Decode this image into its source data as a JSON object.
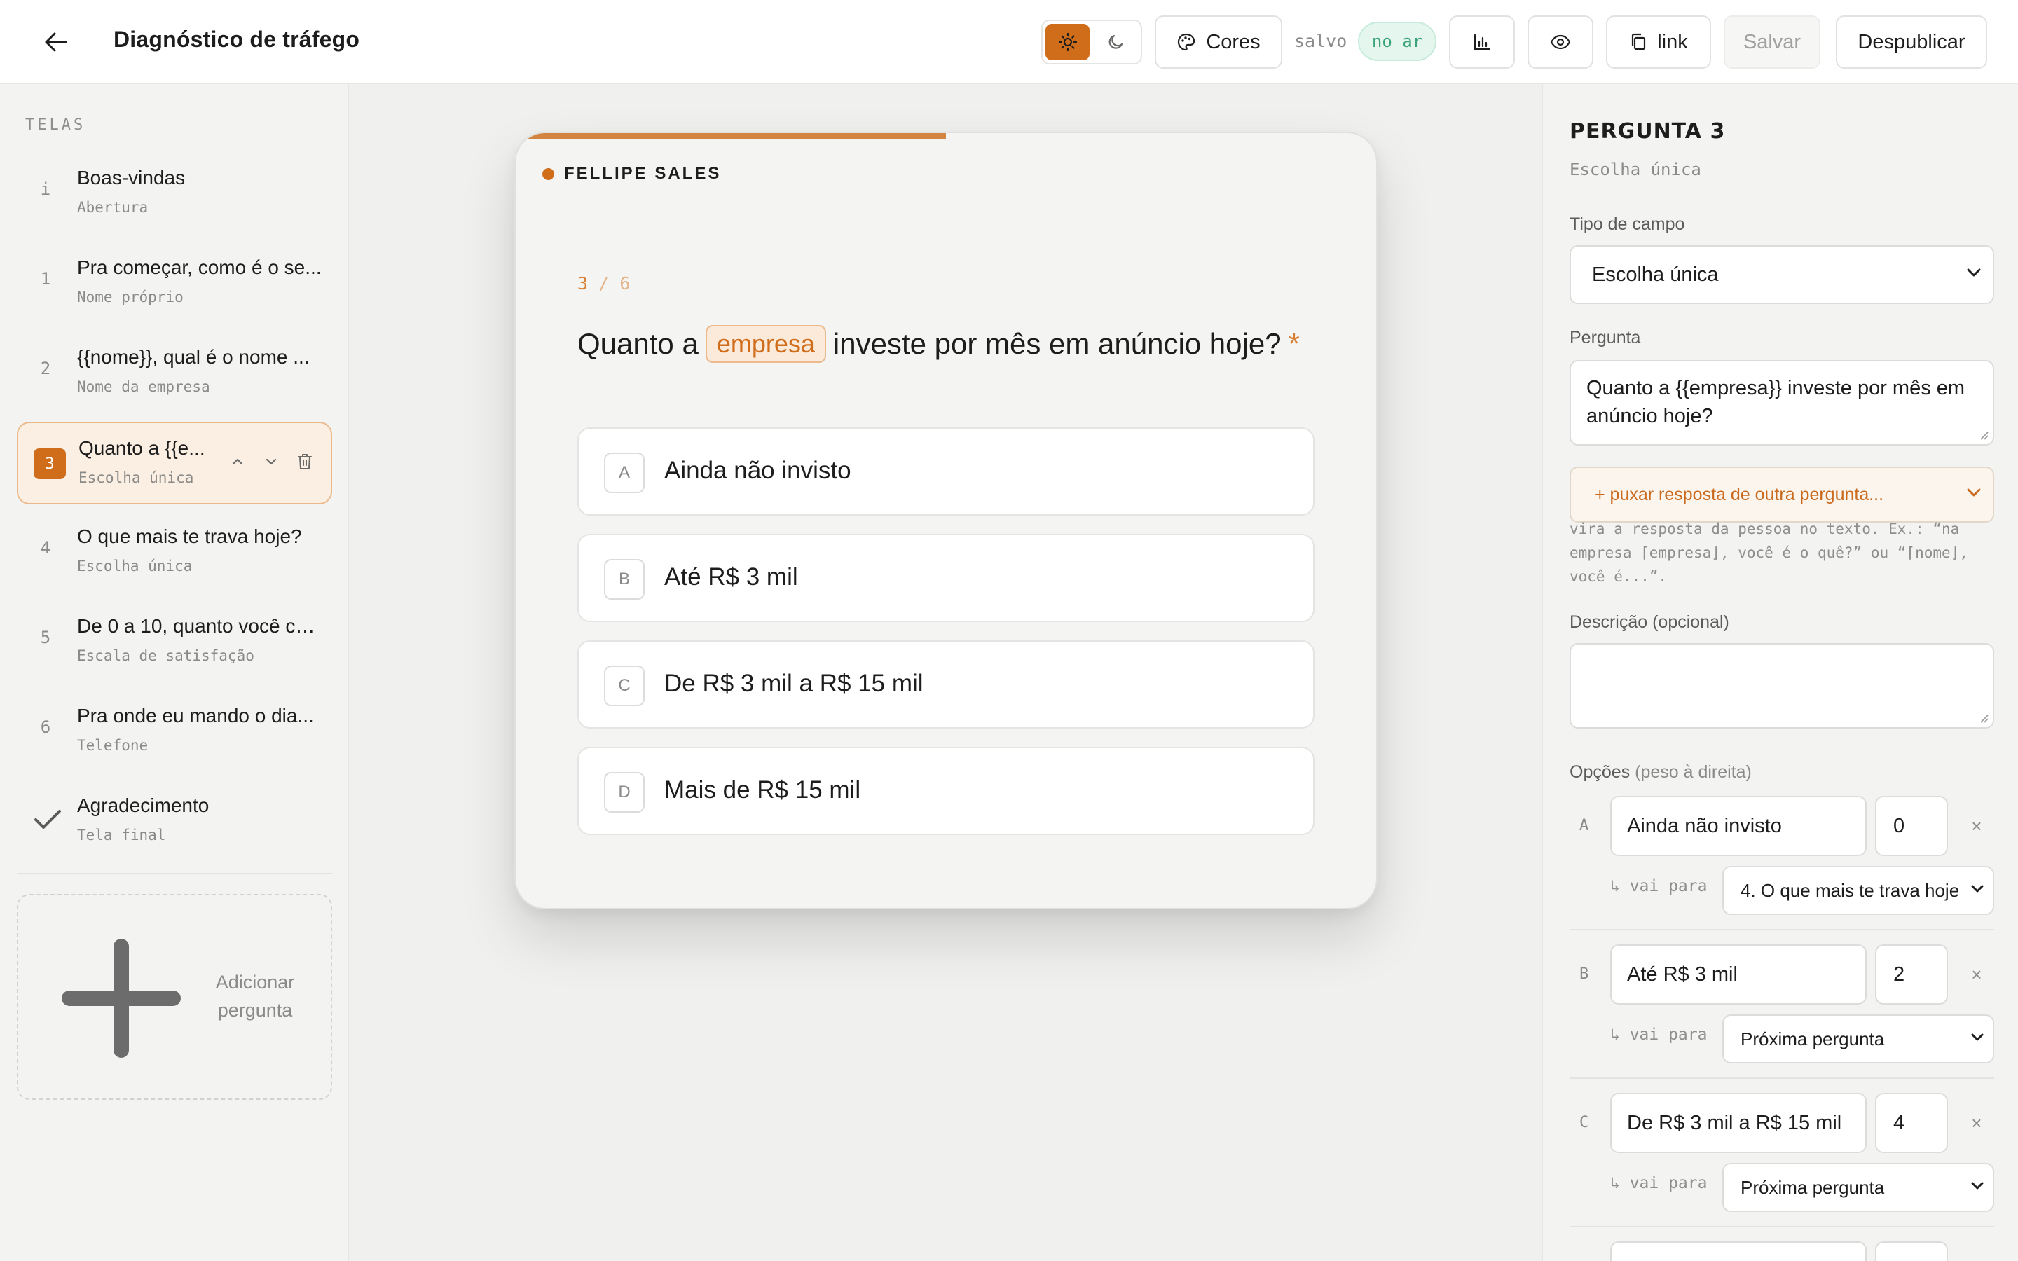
{
  "header": {
    "title": "Diagnóstico de tráfego",
    "colors_label": "Cores",
    "saved_label": "salvo",
    "status": "no ar",
    "link_label": "link",
    "save_label": "Salvar",
    "unpublish_label": "Despublicar"
  },
  "sidebar": {
    "heading": "TELAS",
    "items": [
      {
        "num": "i",
        "title": "Boas-vindas",
        "sub": "Abertura"
      },
      {
        "num": "1",
        "title": "Pra começar, como é o se...",
        "sub": "Nome próprio"
      },
      {
        "num": "2",
        "title": "{{nome}}, qual é o nome ...",
        "sub": "Nome da empresa"
      },
      {
        "num": "3",
        "title": "Quanto a {{e...",
        "sub": "Escolha única"
      },
      {
        "num": "4",
        "title": "O que mais te trava hoje?",
        "sub": "Escolha única"
      },
      {
        "num": "5",
        "title": "De 0 a 10, quanto você co...",
        "sub": "Escala de satisfação"
      },
      {
        "num": "6",
        "title": "Pra onde eu mando o dia...",
        "sub": "Telefone"
      },
      {
        "num": "",
        "title": "Agradecimento",
        "sub": "Tela final"
      }
    ],
    "add_label": "Adicionar pergunta"
  },
  "preview": {
    "brand": "FELLIPE SALES",
    "step_current": "3",
    "step_rest": " / 6",
    "question_before": "Quanto a",
    "question_chip": "empresa",
    "question_after": "investe por mês em anúncio hoje?",
    "required_mark": "*",
    "progress": 0.5,
    "answers": [
      {
        "key": "A",
        "text": "Ainda não invisto"
      },
      {
        "key": "B",
        "text": "Até R$ 3 mil"
      },
      {
        "key": "C",
        "text": "De R$ 3 mil a R$ 15 mil"
      },
      {
        "key": "D",
        "text": "Mais de R$ 15 mil"
      }
    ]
  },
  "editor": {
    "title": "PERGUNTA 3",
    "subtitle": "Escolha única",
    "field_type_label": "Tipo de campo",
    "field_type_value": "Escolha única",
    "question_label": "Pergunta",
    "question_value": "Quanto a {{empresa}} investe por mês em anúncio hoje?",
    "pull_answer": "+ puxar resposta de outra pergunta...",
    "help_text": "vira a resposta da pessoa no texto. Ex.: “na empresa ⌈empresa⌋, você é o quê?” ou “⌈nome⌋, você é...”.",
    "description_label": "Descrição (opcional)",
    "description_value": "",
    "options_label": "Opções",
    "options_hint": "(peso à direita)",
    "goto_label": "↳ vai para",
    "options": [
      {
        "letter": "A",
        "text": "Ainda não invisto",
        "weight": "0",
        "goto": "4. O que mais te trava hoje"
      },
      {
        "letter": "B",
        "text": "Até R$ 3 mil",
        "weight": "2",
        "goto": "Próxima pergunta"
      },
      {
        "letter": "C",
        "text": "De R$ 3 mil a R$ 15 mil",
        "weight": "4",
        "goto": "Próxima pergunta"
      }
    ],
    "remove_glyph": "×"
  },
  "colors": {
    "accent": "#d06d1b",
    "accent_light": "#fbeee2",
    "status_green": "#3aa37a"
  }
}
